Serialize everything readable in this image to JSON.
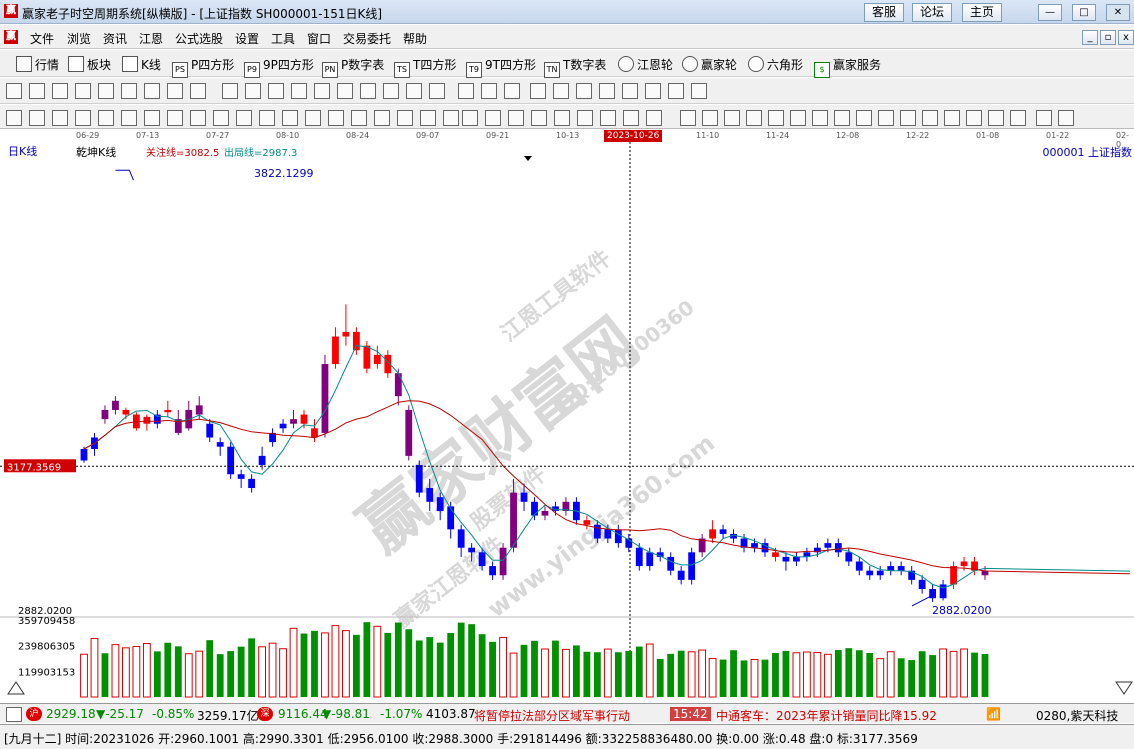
{
  "window": {
    "title": "赢家老子时空周期系统[纵横版] - [上证指数  SH000001-151日K线]",
    "top_buttons": [
      "客服",
      "论坛",
      "主页"
    ],
    "controls": [
      "—",
      "□",
      "✕"
    ]
  },
  "menu": [
    "文件",
    "浏览",
    "资讯",
    "江恩",
    "公式选股",
    "设置",
    "工具",
    "窗口",
    "交易委托",
    "帮助"
  ],
  "toolbar1": [
    "行情",
    "板块",
    "K线",
    "P四方形",
    "9P四方形",
    "P数字表",
    "T四方形",
    "9T四方形",
    "T数字表",
    "江恩轮",
    "赢家轮",
    "六角形",
    "赢家服务"
  ],
  "dates": [
    "06-29",
    "07-13",
    "07-27",
    "08-10",
    "08-24",
    "09-07",
    "09-21",
    "10-13",
    "2023-10-26",
    "11-10",
    "11-24",
    "12-08",
    "12-22",
    "01-08",
    "01-22",
    "02-0"
  ],
  "chart": {
    "period_label": "日K线",
    "indicator_name": "乾坤K线",
    "focus_line": "关注线=3082.5",
    "exit_line": "出局线=2987.3",
    "symbol": "000001  上证指数",
    "high_label": "3822.1299",
    "low_label": "2882.0200",
    "low_axis": "2882.0200",
    "crosshair_price": "3177.3569",
    "vol_ticks": [
      "359709458",
      "239806305",
      "119903153"
    ],
    "watermark": [
      "赢家财富网",
      "赢家江恩软件",
      "www.yingjia360.com",
      "江恩工具软件",
      "股票软件",
      "QQ:100800360"
    ],
    "colors": {
      "up": "#ff0000",
      "down": "#0000ff",
      "reverse": "#800080",
      "ma_fast": "#008b8b",
      "ma_slow": "#c00000",
      "vol_up": "#dd0000",
      "vol_down": "#009000"
    }
  },
  "status": {
    "idx1_val": "2929.18",
    "idx1_chg": "▼-25.17",
    "idx1_pct": "-0.85%",
    "idx1_amt": "3259.17亿",
    "idx2_val": "9116.44",
    "idx2_chg": "▼-98.81",
    "idx2_pct": "-1.07%",
    "idx2_amt": "4103.87",
    "news1": "将暂停拉法部分区域军事行动",
    "time": "15:42",
    "news2": "中通客车：2023年累计销量同比降15.92",
    "ticker": "0280,紫天科技"
  },
  "quote": "[九月十二] 时间:20231026 开:2960.1001 高:2990.3301 低:2956.0100 收:2988.3000 手:291814496 额:332258836480.00 换:0.00 涨:0.48 盘:0 标:3177.3569",
  "chart_data": {
    "type": "candlestick",
    "dates_visible": [
      "06-29",
      "07-13",
      "07-27",
      "08-10",
      "08-24",
      "09-07",
      "09-21",
      "10-13",
      "2023-10-26",
      "11-10",
      "11-24",
      "12-08",
      "12-22",
      "01-08",
      "01-22"
    ],
    "price_range": [
      2860,
      3840
    ],
    "marks": {
      "high": 3822.13,
      "low": 2882.02,
      "crosshair": 3177.36
    },
    "candles": [
      [
        3190,
        3215,
        3185,
        3220,
        "d"
      ],
      [
        3215,
        3240,
        3200,
        3250,
        "d"
      ],
      [
        3300,
        3280,
        3270,
        3310,
        "r"
      ],
      [
        3300,
        3320,
        3290,
        3330,
        "r"
      ],
      [
        3290,
        3300,
        3280,
        3305,
        "u"
      ],
      [
        3260,
        3290,
        3255,
        3295,
        "u"
      ],
      [
        3270,
        3285,
        3255,
        3290,
        "u"
      ],
      [
        3290,
        3270,
        3260,
        3300,
        "d"
      ],
      [
        3300,
        3295,
        3285,
        3320,
        "u"
      ],
      [
        3280,
        3250,
        3245,
        3300,
        "r"
      ],
      [
        3260,
        3300,
        3255,
        3320,
        "r"
      ],
      [
        3290,
        3310,
        3280,
        3330,
        "r"
      ],
      [
        3270,
        3240,
        3230,
        3280,
        "d"
      ],
      [
        3230,
        3220,
        3200,
        3240,
        "d"
      ],
      [
        3220,
        3160,
        3150,
        3230,
        "d"
      ],
      [
        3160,
        3150,
        3130,
        3170,
        "d"
      ],
      [
        3150,
        3130,
        3120,
        3160,
        "d"
      ],
      [
        3180,
        3200,
        3170,
        3220,
        "d"
      ],
      [
        3230,
        3250,
        3220,
        3260,
        "d"
      ],
      [
        3260,
        3270,
        3250,
        3280,
        "d"
      ],
      [
        3270,
        3280,
        3260,
        3300,
        "r"
      ],
      [
        3290,
        3270,
        3260,
        3300,
        "u"
      ],
      [
        3260,
        3240,
        3230,
        3280,
        "u"
      ],
      [
        3250,
        3400,
        3240,
        3420,
        "r"
      ],
      [
        3400,
        3460,
        3390,
        3480,
        "u"
      ],
      [
        3460,
        3470,
        3440,
        3530,
        "u"
      ],
      [
        3470,
        3430,
        3420,
        3480,
        "u"
      ],
      [
        3440,
        3390,
        3380,
        3450,
        "u"
      ],
      [
        3400,
        3420,
        3390,
        3440,
        "u"
      ],
      [
        3420,
        3380,
        3370,
        3430,
        "u"
      ],
      [
        3380,
        3330,
        3310,
        3390,
        "r"
      ],
      [
        3300,
        3200,
        3190,
        3310,
        "r"
      ],
      [
        3180,
        3120,
        3110,
        3190,
        "d"
      ],
      [
        3130,
        3100,
        3080,
        3150,
        "d"
      ],
      [
        3110,
        3080,
        3060,
        3120,
        "d"
      ],
      [
        3090,
        3040,
        3020,
        3100,
        "d"
      ],
      [
        3040,
        3000,
        2980,
        3050,
        "d"
      ],
      [
        3000,
        2990,
        2970,
        3010,
        "d"
      ],
      [
        2990,
        2960,
        2950,
        3000,
        "d"
      ],
      [
        2960,
        2940,
        2930,
        2970,
        "d"
      ],
      [
        2940,
        3000,
        2930,
        3010,
        "r"
      ],
      [
        3000,
        3120,
        2990,
        3150,
        "r"
      ],
      [
        3120,
        3100,
        3080,
        3140,
        "d"
      ],
      [
        3100,
        3070,
        3060,
        3110,
        "d"
      ],
      [
        3070,
        3080,
        3060,
        3090,
        "r"
      ],
      [
        3090,
        3080,
        3070,
        3100,
        "d"
      ],
      [
        3080,
        3100,
        3070,
        3110,
        "r"
      ],
      [
        3100,
        3060,
        3050,
        3110,
        "d"
      ],
      [
        3060,
        3050,
        3040,
        3070,
        "u"
      ],
      [
        3050,
        3020,
        3010,
        3060,
        "d"
      ],
      [
        3020,
        3040,
        3010,
        3050,
        "d"
      ],
      [
        3040,
        3010,
        3000,
        3050,
        "d"
      ],
      [
        3020,
        3000,
        2990,
        3030,
        "d"
      ],
      [
        3000,
        2960,
        2950,
        3010,
        "d"
      ],
      [
        2960,
        2990,
        2950,
        3000,
        "d"
      ],
      [
        2990,
        2980,
        2970,
        3000,
        "d"
      ],
      [
        2980,
        2950,
        2940,
        2990,
        "d"
      ],
      [
        2950,
        2930,
        2920,
        2960,
        "d"
      ],
      [
        2930,
        2990,
        2920,
        3000,
        "d"
      ],
      [
        2990,
        3020,
        2980,
        3030,
        "r"
      ],
      [
        3020,
        3040,
        3010,
        3060,
        "u"
      ],
      [
        3040,
        3030,
        3020,
        3050,
        "d"
      ],
      [
        3030,
        3020,
        3010,
        3040,
        "d"
      ],
      [
        3020,
        3000,
        2990,
        3030,
        "d"
      ],
      [
        3000,
        3010,
        2990,
        3020,
        "d"
      ],
      [
        3010,
        2990,
        2980,
        3020,
        "d"
      ],
      [
        2990,
        2980,
        2970,
        3000,
        "u"
      ],
      [
        2980,
        2970,
        2950,
        2990,
        "d"
      ],
      [
        2970,
        2980,
        2960,
        2990,
        "d"
      ],
      [
        2980,
        2990,
        2970,
        3000,
        "d"
      ],
      [
        2990,
        3000,
        2980,
        3010,
        "d"
      ],
      [
        3000,
        3010,
        2990,
        3020,
        "d"
      ],
      [
        3010,
        2990,
        2980,
        3020,
        "d"
      ],
      [
        2990,
        2970,
        2960,
        3000,
        "d"
      ],
      [
        2970,
        2950,
        2940,
        2980,
        "d"
      ],
      [
        2950,
        2940,
        2930,
        2960,
        "d"
      ],
      [
        2940,
        2950,
        2930,
        2960,
        "d"
      ],
      [
        2950,
        2960,
        2940,
        2970,
        "d"
      ],
      [
        2960,
        2950,
        2940,
        2970,
        "d"
      ],
      [
        2950,
        2930,
        2920,
        2960,
        "d"
      ],
      [
        2930,
        2910,
        2900,
        2940,
        "d"
      ],
      [
        2910,
        2890,
        2882,
        2920,
        "d"
      ],
      [
        2890,
        2920,
        2885,
        2930,
        "d"
      ],
      [
        2920,
        2960,
        2910,
        2970,
        "u"
      ],
      [
        2960,
        2970,
        2950,
        2980,
        "u"
      ],
      [
        2970,
        2950,
        2940,
        2980,
        "u"
      ],
      [
        2950,
        2940,
        2930,
        2960,
        "r"
      ]
    ],
    "volume_range": [
      0,
      360000000
    ]
  }
}
